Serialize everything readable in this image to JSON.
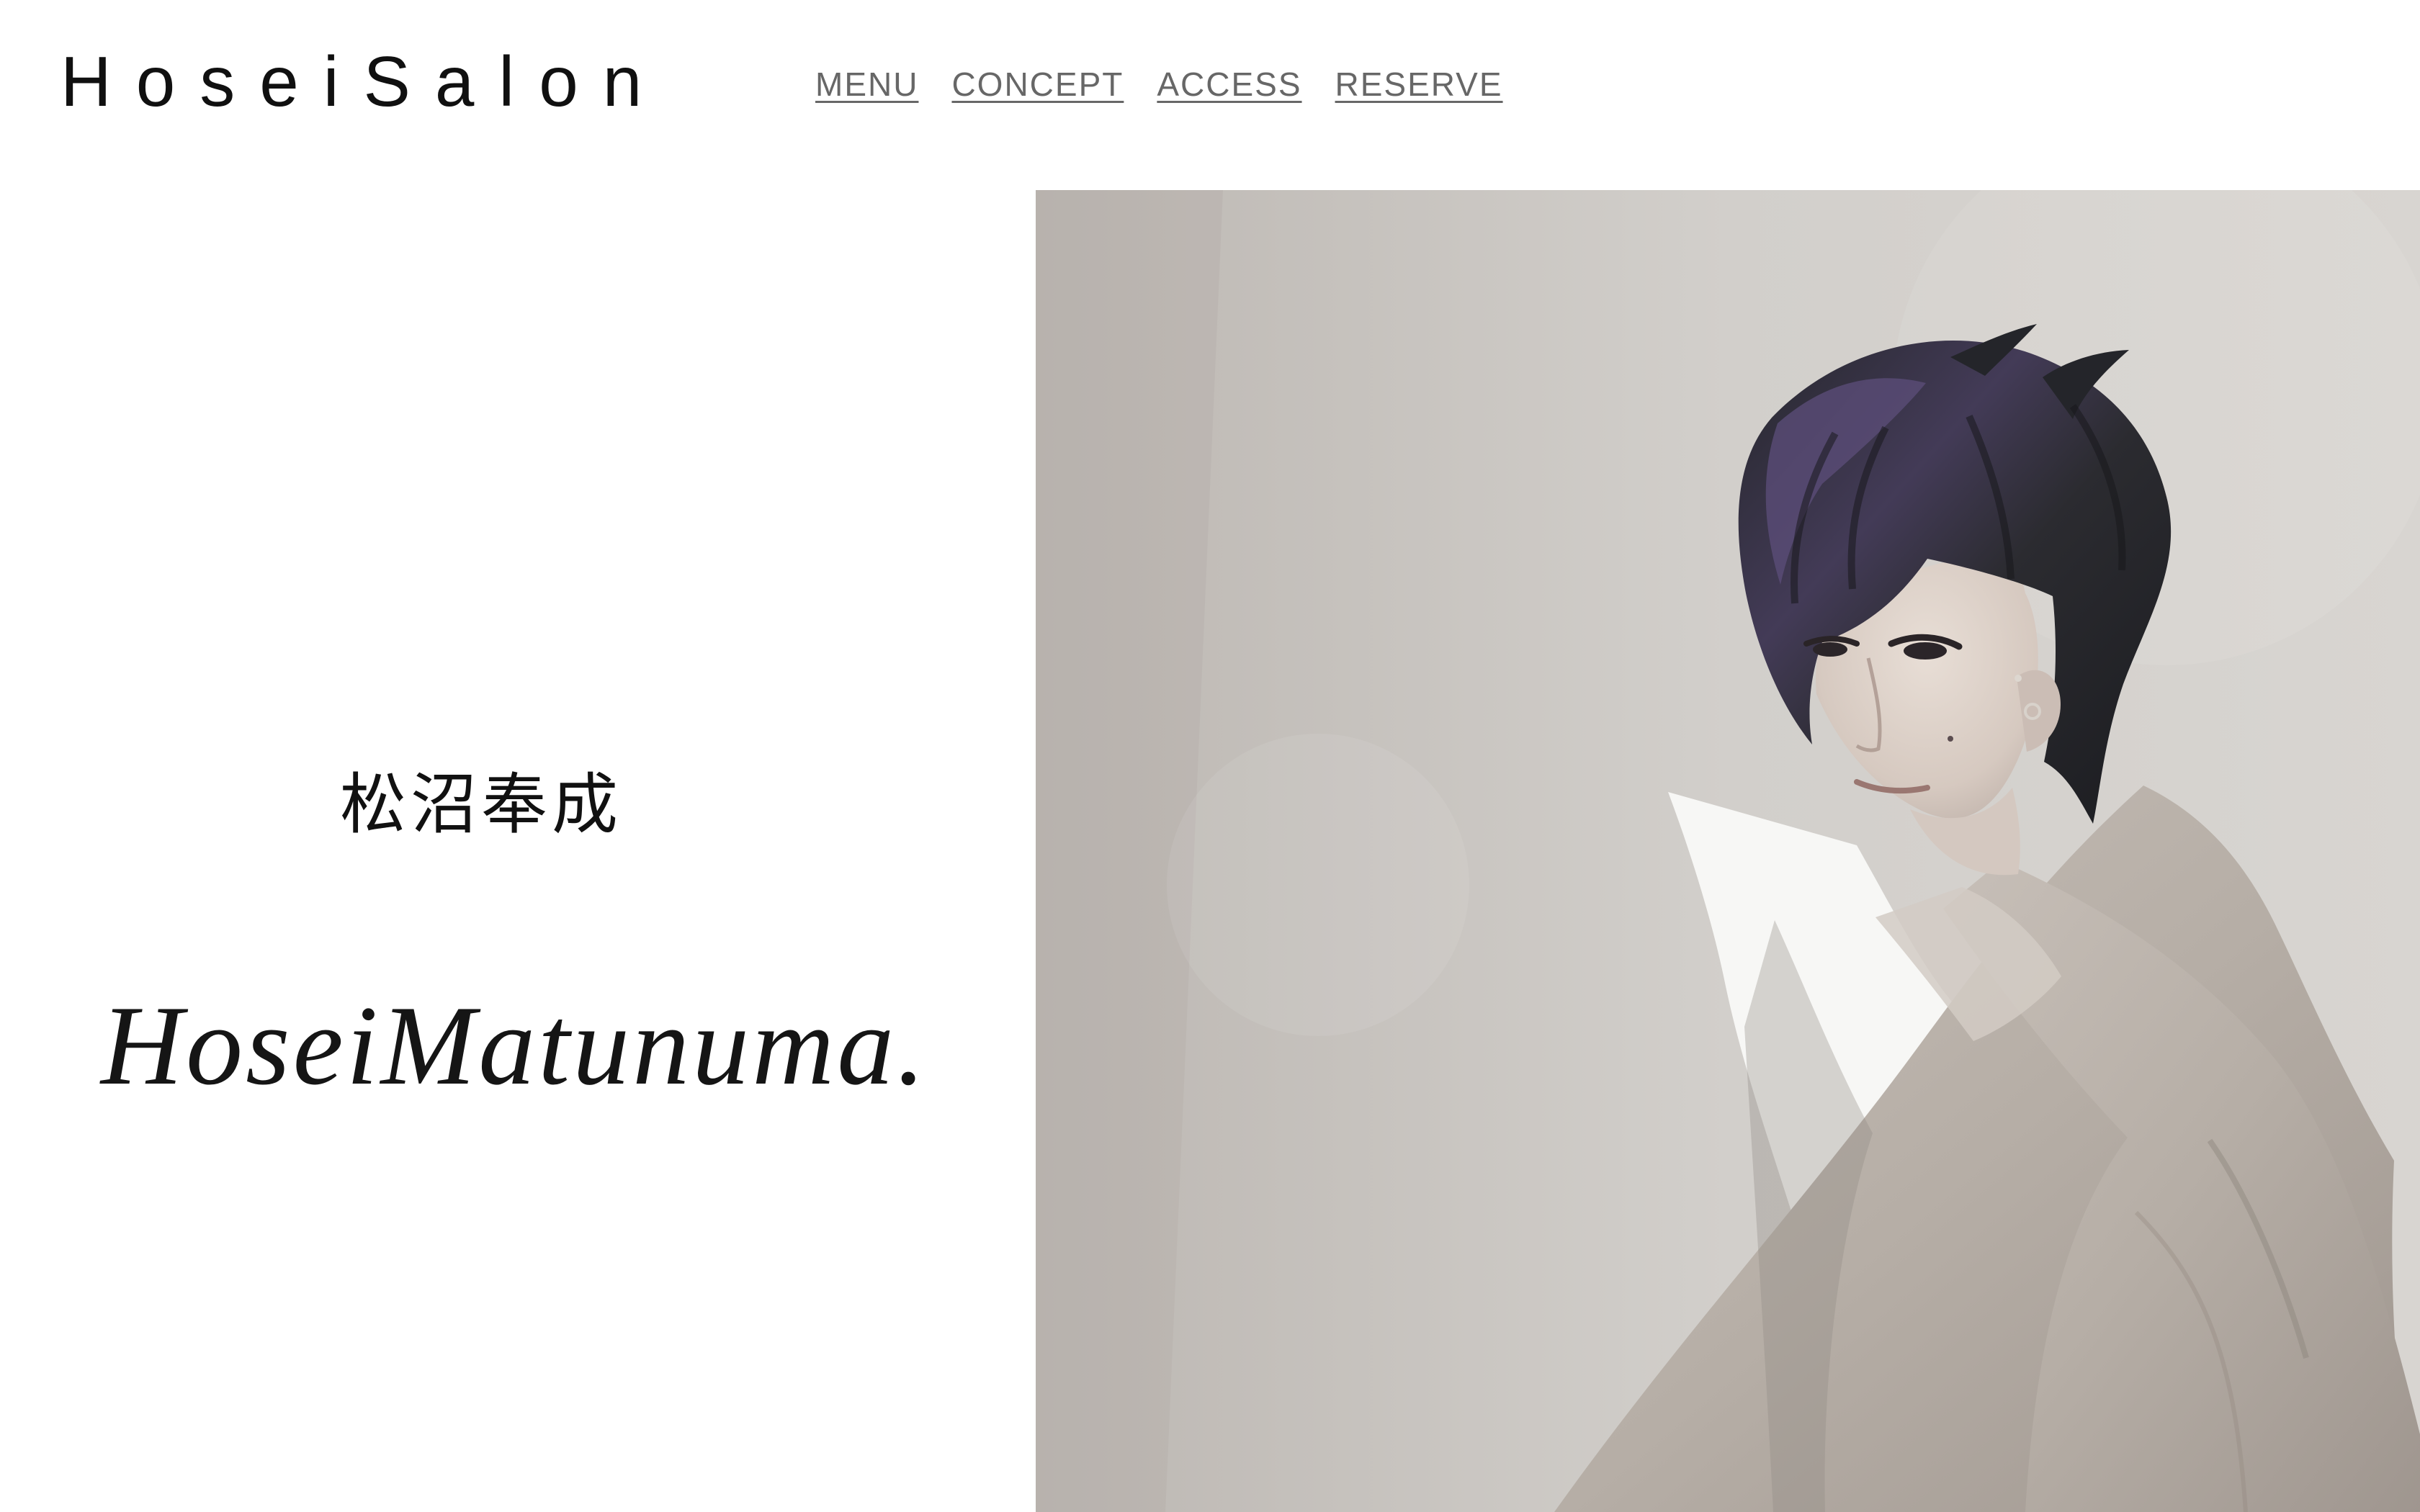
{
  "brand": {
    "name": "HoseiSalon"
  },
  "nav": {
    "items": [
      {
        "label": "MENU"
      },
      {
        "label": "CONCEPT"
      },
      {
        "label": "ACCESS"
      },
      {
        "label": "RESERVE"
      }
    ]
  },
  "hero": {
    "name_japanese": "松沼奉成",
    "name_english": "HoseiMatunuma."
  },
  "colors": {
    "background": "#ffffff",
    "text": "#111111",
    "nav_link": "#676767",
    "photo_wall": "#cbc8c4",
    "jacket": "#b8b1aa",
    "hair": "#302d31",
    "hair_highlight": "#5b4d78"
  }
}
